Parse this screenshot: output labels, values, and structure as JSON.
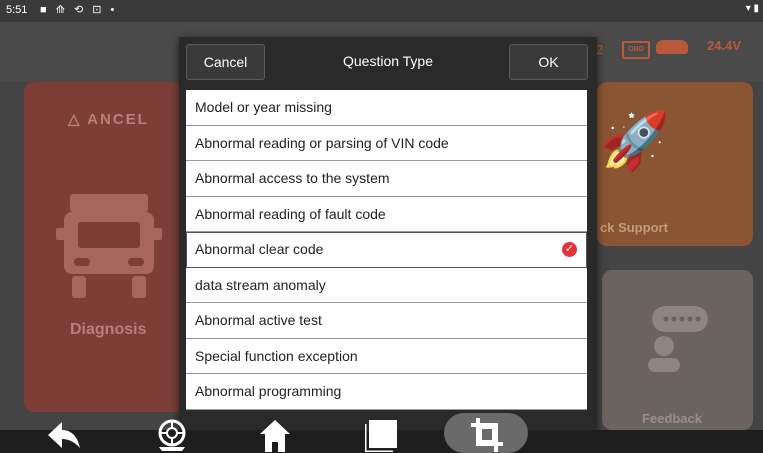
{
  "status_bar": {
    "time": "5:51",
    "notification_icons": "■ ⟰ ⟲ ⊡ •",
    "system_icons": "▾ ▮"
  },
  "background": {
    "number": "2",
    "obd_label": "OBD",
    "battery_voltage": "24.4V",
    "brand": "ANCEL",
    "tiles": {
      "diagnosis": "Diagnosis",
      "support": "ck Support",
      "feedback": "Feedback"
    }
  },
  "dialog": {
    "title": "Question Type",
    "cancel_label": "Cancel",
    "ok_label": "OK",
    "items": [
      {
        "label": "Model or year missing",
        "selected": false
      },
      {
        "label": "Abnormal reading or parsing of VIN code",
        "selected": false
      },
      {
        "label": "Abnormal access to the system",
        "selected": false
      },
      {
        "label": "Abnormal reading of fault code",
        "selected": false
      },
      {
        "label": "Abnormal clear code",
        "selected": true
      },
      {
        "label": "data stream anomaly",
        "selected": false
      },
      {
        "label": "Abnormal active test",
        "selected": false
      },
      {
        "label": "Special function exception",
        "selected": false
      },
      {
        "label": "Abnormal programming",
        "selected": false
      }
    ],
    "selected_color": "#e0343a"
  },
  "nav_bar": {
    "icons": [
      "back-icon",
      "wheel-icon",
      "home-icon",
      "recents-icon",
      "crop-icon"
    ]
  }
}
